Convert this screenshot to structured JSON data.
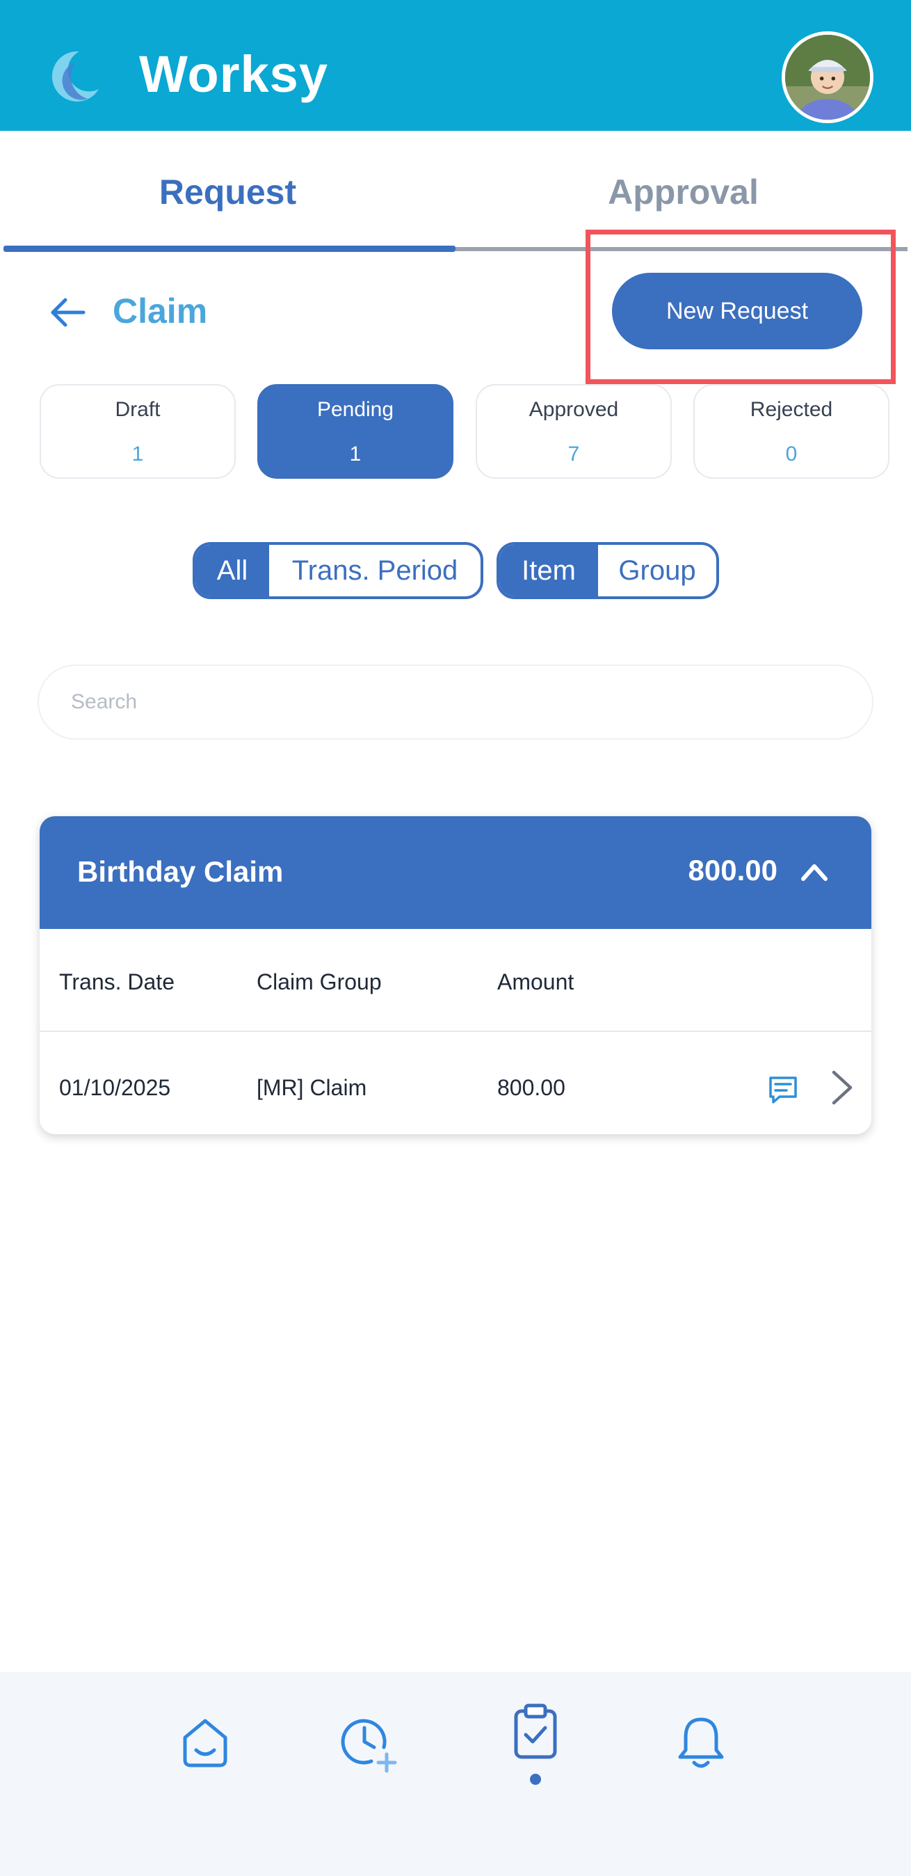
{
  "app": {
    "title": "Worksy",
    "brand_color": "#0aa8d3",
    "accent_color": "#3b6fbf",
    "logo_icon": "crescent-moon-icon",
    "avatar": "user-avatar"
  },
  "tabs": [
    {
      "label": "Request",
      "active": true
    },
    {
      "label": "Approval",
      "active": false
    }
  ],
  "page": {
    "title": "Claim",
    "back_icon": "arrow-left-icon",
    "new_request_label": "New Request"
  },
  "status_filters": [
    {
      "label": "Draft",
      "count": "1",
      "active": false
    },
    {
      "label": "Pending",
      "count": "1",
      "active": true
    },
    {
      "label": "Approved",
      "count": "7",
      "active": false
    },
    {
      "label": "Rejected",
      "count": "0",
      "active": false
    }
  ],
  "period_toggle": {
    "options": [
      "All",
      "Trans. Period"
    ],
    "selected": "All"
  },
  "view_toggle": {
    "options": [
      "Item",
      "Group"
    ],
    "selected": "Item"
  },
  "search": {
    "placeholder": "Search",
    "value": ""
  },
  "claim_group": {
    "title": "Birthday Claim",
    "total": "800.00",
    "expanded": true,
    "columns": [
      "Trans. Date",
      "Claim Group",
      "Amount"
    ],
    "rows": [
      {
        "date": "01/10/2025",
        "group": "[MR] Claim",
        "amount": "800.00",
        "has_comment": true
      }
    ]
  },
  "bottom_nav": [
    {
      "icon": "home-icon",
      "active": false
    },
    {
      "icon": "clock-add-icon",
      "active": false
    },
    {
      "icon": "clipboard-check-icon",
      "active": true
    },
    {
      "icon": "bell-icon",
      "active": false
    }
  ]
}
